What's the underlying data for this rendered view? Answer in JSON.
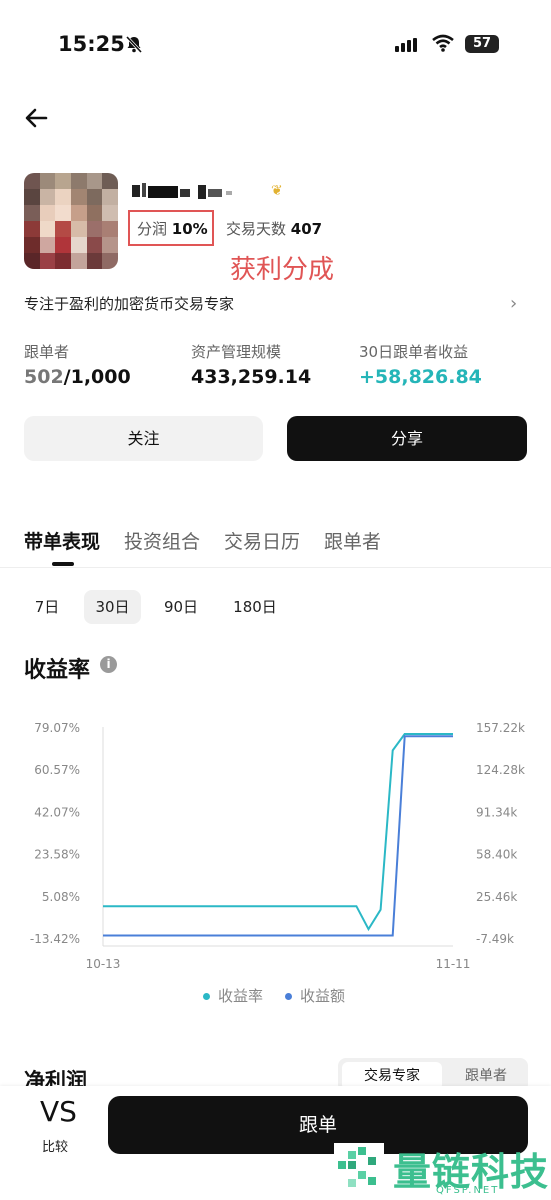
{
  "status_bar": {
    "time": "15:25",
    "battery": "57"
  },
  "profile": {
    "profit_share_label": "分润",
    "profit_share_value": "10%",
    "trade_days_label": "交易天数",
    "trade_days_value": "407",
    "annotation": "获利分成",
    "bio": "专注于盈利的加密货币交易专家"
  },
  "stats": {
    "followers_label": "跟单者",
    "followers_current": "502",
    "followers_max": "/1,000",
    "aum_label": "资产管理规模",
    "aum_value": "433,259.14",
    "pnl_label": "30日跟单者收益",
    "pnl_value": "+58,826.84"
  },
  "actions": {
    "follow": "关注",
    "share": "分享",
    "copy": "跟单"
  },
  "tabs": [
    "带单表现",
    "投资组合",
    "交易日历",
    "跟单者"
  ],
  "periods": [
    "7日",
    "30日",
    "90日",
    "180日"
  ],
  "section_title": "收益率",
  "chart_data": {
    "type": "line",
    "x_start": "10-13",
    "x_end": "11-11",
    "x_ticks": [
      "10-13",
      "11-11"
    ],
    "left_axis_ticks": [
      "79.07%",
      "60.57%",
      "42.07%",
      "23.58%",
      "5.08%",
      "-13.42%"
    ],
    "right_axis_ticks": [
      "157.22k",
      "124.28k",
      "91.34k",
      "58.40k",
      "25.46k",
      "-7.49k"
    ],
    "ylim_left": [
      -13.42,
      79.07
    ],
    "ylim_right": [
      -7.49,
      157.22
    ],
    "series": [
      {
        "name": "收益率",
        "color": "#2bb8c6",
        "axis": "left",
        "values": [
          0.5,
          0.5,
          0.5,
          0.5,
          0.5,
          0.5,
          0.5,
          0.5,
          0.5,
          0.5,
          0.5,
          0.5,
          0.5,
          0.5,
          0.5,
          0.5,
          0.5,
          0.5,
          0.5,
          0.5,
          0.5,
          0.5,
          -9.5,
          -1.0,
          68.8,
          76.0,
          76.0,
          76.0,
          76.0,
          76.0
        ]
      },
      {
        "name": "收益额",
        "color": "#4a7fd8",
        "axis": "right",
        "values": [
          -5.5,
          -5.5,
          -5.5,
          -5.5,
          -5.5,
          -5.5,
          -5.5,
          -5.5,
          -5.5,
          -5.5,
          -5.5,
          -5.5,
          -5.5,
          -5.5,
          -5.5,
          -5.5,
          -5.5,
          -5.5,
          -5.5,
          -5.5,
          -5.5,
          -5.5,
          -5.5,
          -5.5,
          -5.5,
          150.0,
          150.0,
          150.0,
          150.0,
          150.0
        ]
      }
    ],
    "legend_position": "bottom"
  },
  "net_profit": {
    "title": "净利润",
    "seg_left": "交易专家",
    "seg_right": "跟单者"
  },
  "compare": {
    "vs": "VS",
    "label": "比较"
  },
  "watermark": {
    "text": "量链科技",
    "sub": "QFSP.NET"
  }
}
